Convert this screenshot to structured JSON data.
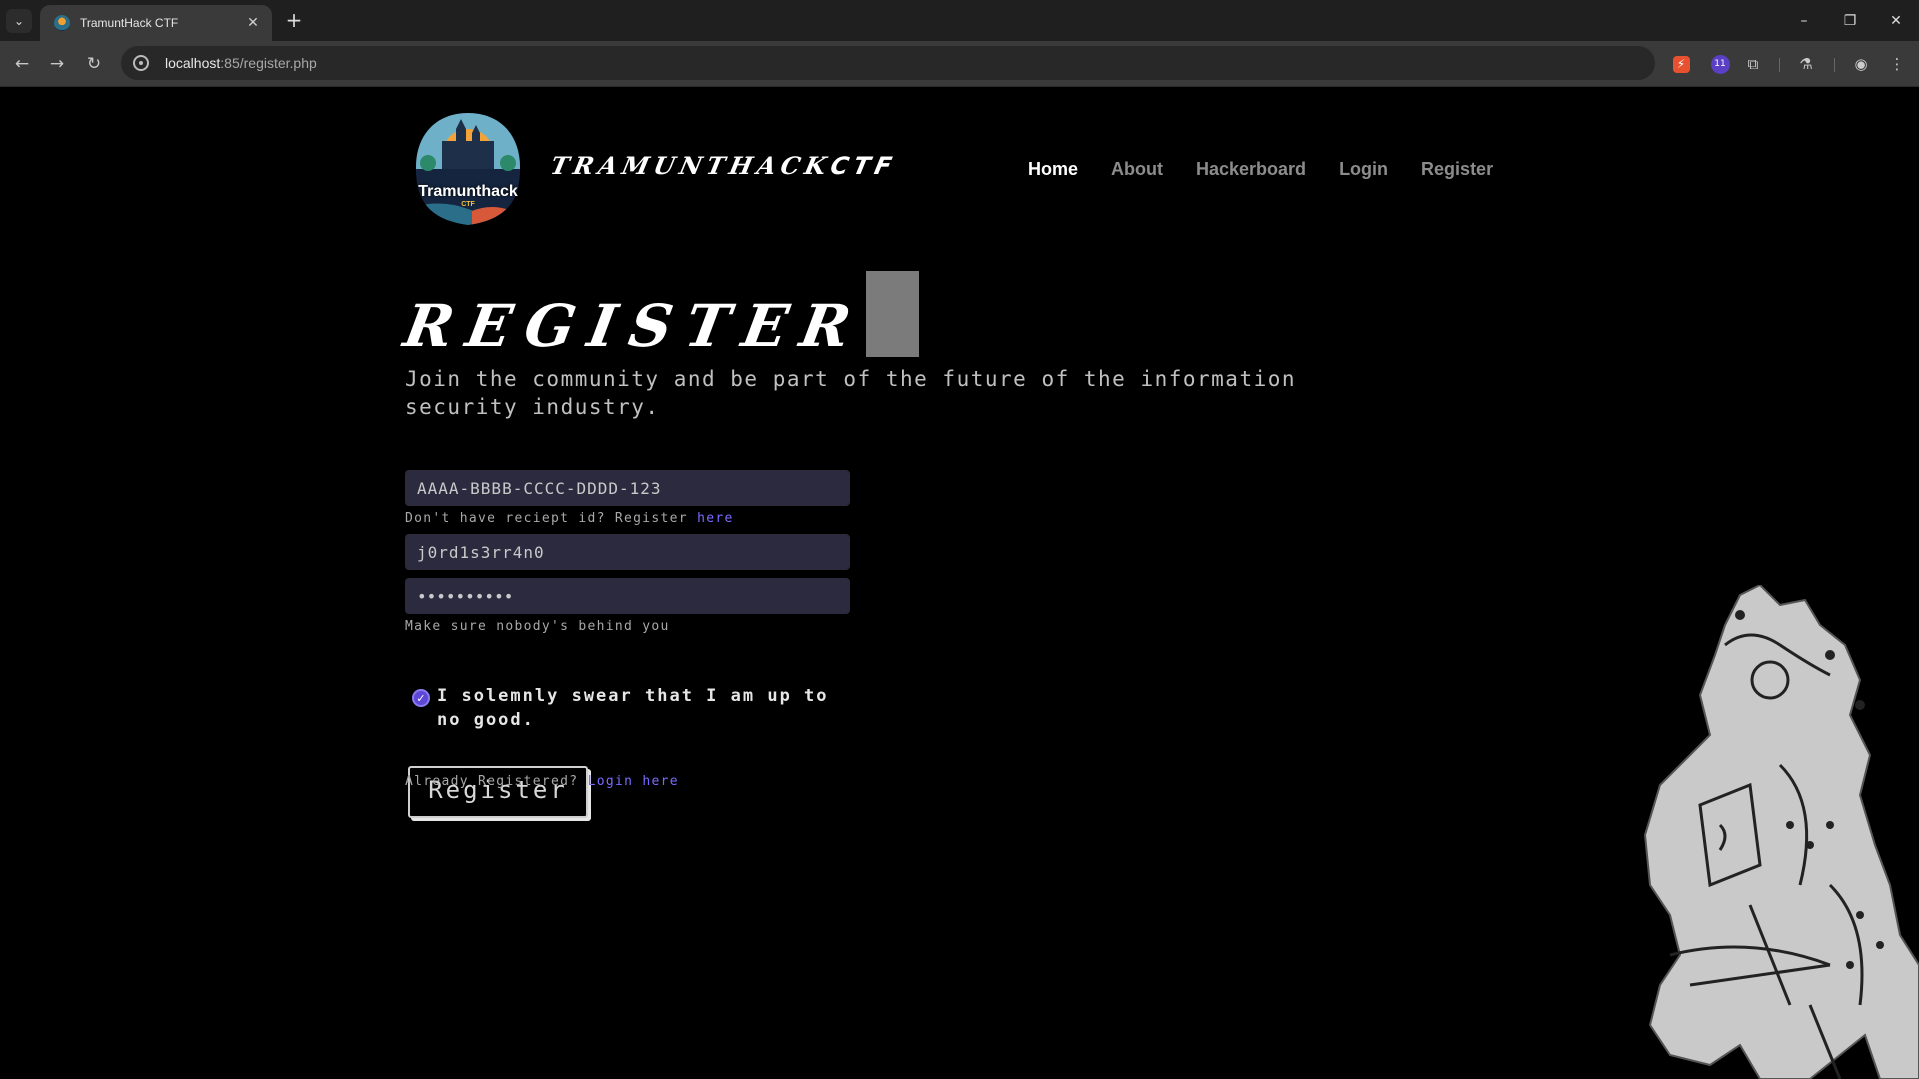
{
  "browser": {
    "tab_title": "TramuntHack CTF",
    "url_host": "localhost",
    "url_path": ":85/register.php",
    "extension_badge": "11"
  },
  "site": {
    "logo_text": "Tramunthack",
    "logo_subtext": "CTF",
    "brand_main": "TRAMUNTHACK",
    "brand_suffix": "CTF",
    "nav": [
      {
        "label": "Home",
        "active": true
      },
      {
        "label": "About",
        "active": false
      },
      {
        "label": "Hackerboard",
        "active": false
      },
      {
        "label": "Login",
        "active": false
      },
      {
        "label": "Register",
        "active": false
      }
    ]
  },
  "register": {
    "title": "REGISTER",
    "subtitle": "Join the community and be part of the future of the information security industry.",
    "receipt_value": "AAAA-BBBB-CCCC-DDDD-123",
    "receipt_hint_prefix": "Don't have reciept id? Register",
    "receipt_hint_link": "here",
    "username_value": "j0rd1s3rr4n0",
    "password_value": "••••••••••",
    "password_hint": "Make sure nobody's behind you",
    "checkbox_label": "I solemnly swear that I am up to no good.",
    "checkbox_checked": true,
    "submit_label": "Register",
    "login_prefix": "Already Registered?",
    "login_link": "Login here"
  },
  "colors": {
    "accent": "#7a6bff",
    "field_bg": "#2b2a3f",
    "background": "#000000"
  }
}
